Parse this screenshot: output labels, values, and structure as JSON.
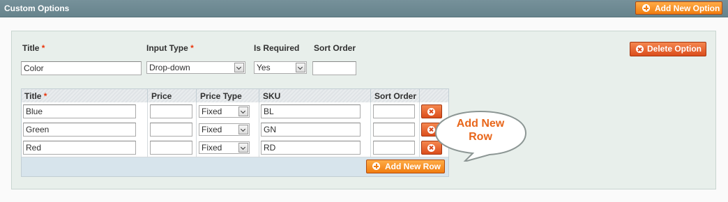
{
  "header": {
    "title": "Custom Options",
    "add_option_label": "Add New Option"
  },
  "option": {
    "title_label": "Title",
    "input_type_label": "Input Type",
    "is_required_label": "Is Required",
    "sort_order_label": "Sort Order",
    "required_marker": "*",
    "title_value": "Color",
    "input_type_value": "Drop-down",
    "is_required_value": "Yes",
    "sort_order_value": "",
    "delete_label": "Delete Option"
  },
  "values_grid": {
    "columns": [
      "Title",
      "Price",
      "Price Type",
      "SKU",
      "Sort Order"
    ],
    "rows": [
      {
        "title": "Blue",
        "price": "",
        "price_type": "Fixed",
        "sku": "BL",
        "sort_order": ""
      },
      {
        "title": "Green",
        "price": "",
        "price_type": "Fixed",
        "sku": "GN",
        "sort_order": ""
      },
      {
        "title": "Red",
        "price": "",
        "price_type": "Fixed",
        "sku": "RD",
        "sort_order": ""
      }
    ],
    "add_row_label": "Add New Row"
  },
  "callout": {
    "line1": "Add New",
    "line2": "Row"
  },
  "colors": {
    "header": "#6e8a93",
    "button_orange": "#f18016",
    "button_red": "#e05a24",
    "panel": "#e8efeb",
    "callout_text": "#e8661a"
  },
  "icons": [
    "plus-circle-icon",
    "close-circle-icon",
    "dropdown-arrow-icon",
    "speech-bubble-shape"
  ]
}
